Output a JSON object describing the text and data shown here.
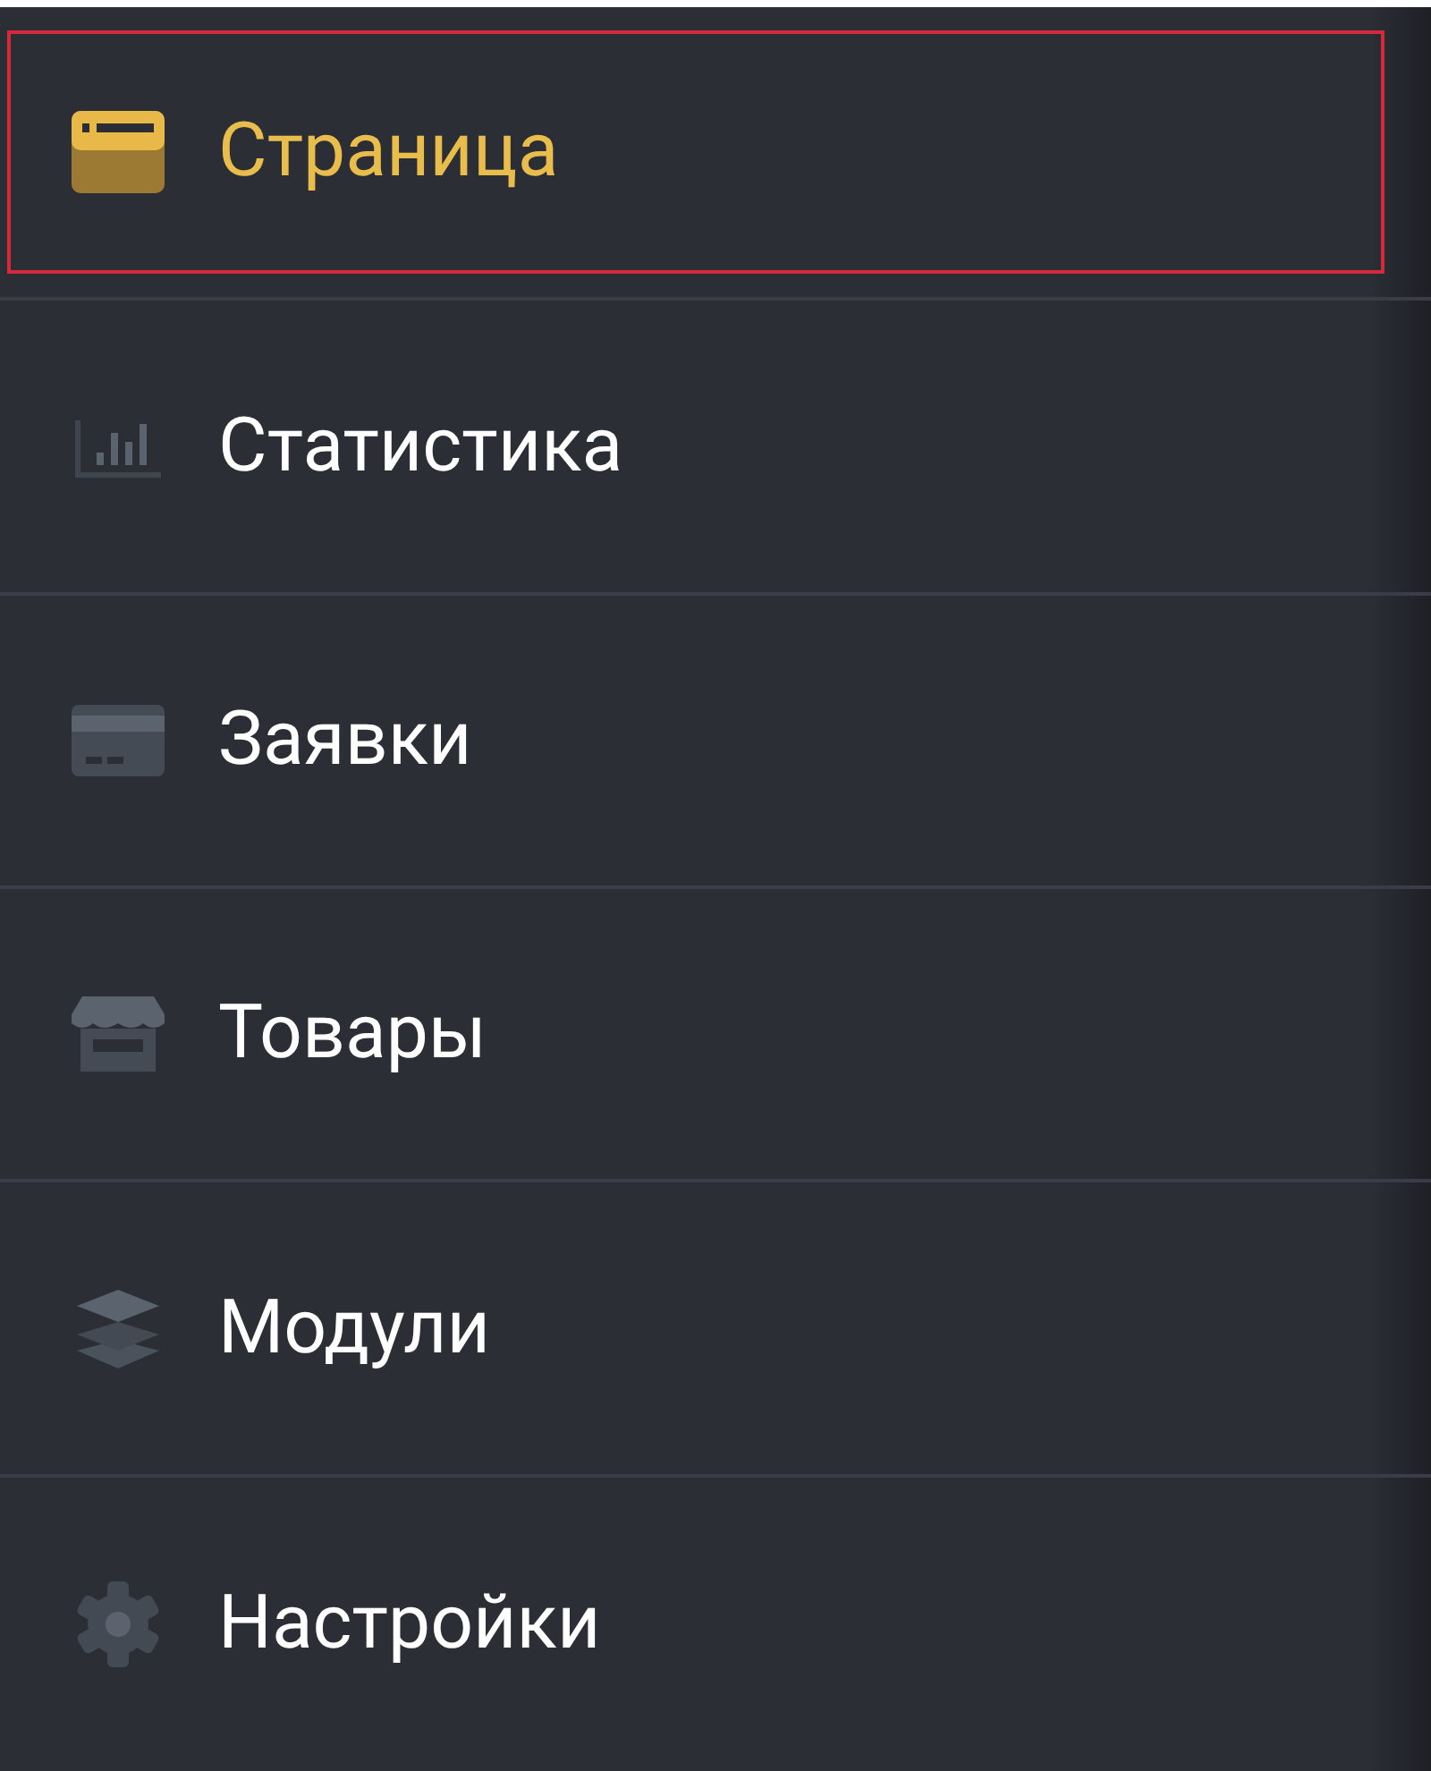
{
  "menu": {
    "items": [
      {
        "label": "Страница",
        "kind": "page",
        "selected": true
      },
      {
        "label": "Статистика",
        "kind": "stats",
        "selected": false
      },
      {
        "label": "Заявки",
        "kind": "card",
        "selected": false
      },
      {
        "label": "Товары",
        "kind": "store",
        "selected": false
      },
      {
        "label": "Модули",
        "kind": "layers",
        "selected": false
      },
      {
        "label": "Настройки",
        "kind": "gear",
        "selected": false
      }
    ]
  }
}
